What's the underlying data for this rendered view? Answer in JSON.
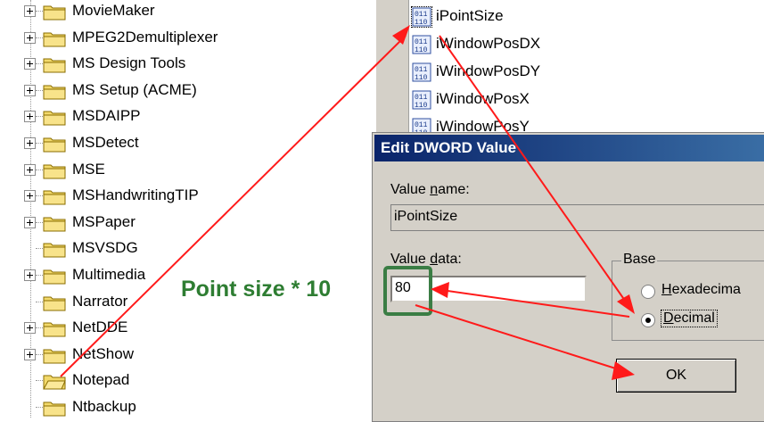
{
  "tree": {
    "items": [
      {
        "label": "MovieMaker",
        "expandable": true
      },
      {
        "label": "MPEG2Demultiplexer",
        "expandable": true
      },
      {
        "label": "MS Design Tools",
        "expandable": true
      },
      {
        "label": "MS Setup (ACME)",
        "expandable": true
      },
      {
        "label": "MSDAIPP",
        "expandable": true
      },
      {
        "label": "MSDetect",
        "expandable": true
      },
      {
        "label": "MSE",
        "expandable": true
      },
      {
        "label": "MSHandwritingTIP",
        "expandable": true
      },
      {
        "label": "MSPaper",
        "expandable": true
      },
      {
        "label": "MSVSDG",
        "expandable": false
      },
      {
        "label": "Multimedia",
        "expandable": true
      },
      {
        "label": "Narrator",
        "expandable": false
      },
      {
        "label": "NetDDE",
        "expandable": true
      },
      {
        "label": "NetShow",
        "expandable": true
      },
      {
        "label": "Notepad",
        "expandable": false,
        "open": true
      },
      {
        "label": "Ntbackup",
        "expandable": false
      }
    ]
  },
  "values": {
    "items": [
      {
        "label": "iPointSize",
        "selected": true
      },
      {
        "label": "iWindowPosDX"
      },
      {
        "label": "iWindowPosDY"
      },
      {
        "label": "iWindowPosX"
      },
      {
        "label": "iWindowPosY"
      }
    ]
  },
  "dialog": {
    "title": "Edit DWORD Value",
    "value_name_label_prefix": "Value ",
    "value_name_label_accel": "n",
    "value_name_label_suffix": "ame:",
    "value_name": "iPointSize",
    "value_data_label_prefix": "Value ",
    "value_data_label_accel": "d",
    "value_data_label_suffix": "ata:",
    "value_data": "80",
    "base_label": "Base",
    "hex_accel": "H",
    "hex_rest": "exadecima",
    "dec_accel": "D",
    "dec_rest": "ecimal",
    "selected_base": "Decimal",
    "ok_label": "OK"
  },
  "annotation": {
    "text": "Point size * 10",
    "color": "#2e7d32",
    "arrow_color": "#ff1a1a"
  }
}
